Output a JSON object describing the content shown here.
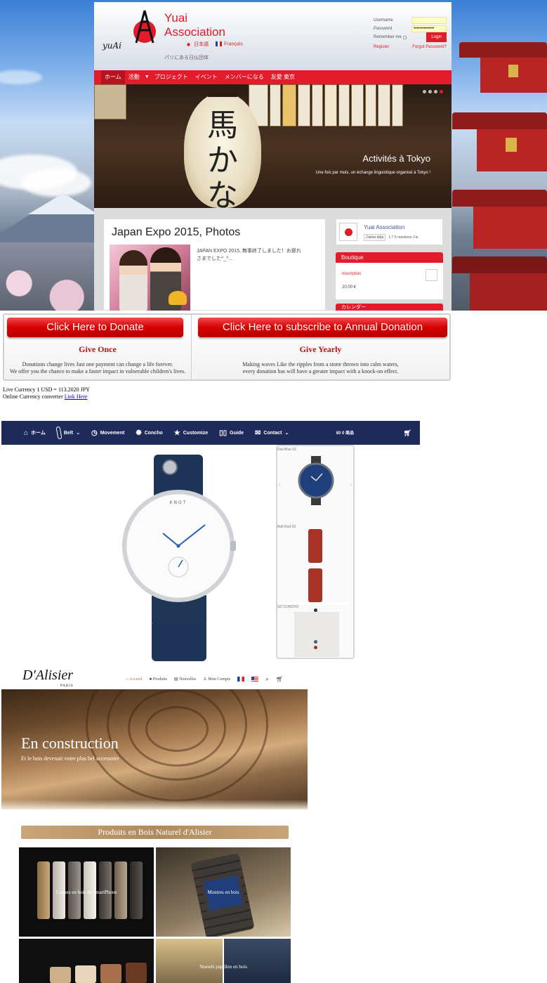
{
  "yuai": {
    "brand_line1": "Yuai",
    "brand_line2": "Association",
    "logo_text": "yuAi",
    "lang_ja": "日本語",
    "lang_fr": "Français",
    "tagline": "パリにある日仏団体",
    "login": {
      "username_label": "Username",
      "password_label": "Password",
      "password_value": "••••••••••••••",
      "remember_label": "Remember me",
      "login_button": "Login",
      "register_link": "Register",
      "forgot_link": "Forgot Password?"
    },
    "nav": [
      "ホーム",
      "活動",
      "プロジェクト",
      "イベント",
      "メンバーになる",
      "友愛 東京"
    ],
    "hero": {
      "title": "Activités à Tokyo",
      "text": "Une fois par mois, un échange linguistique organisé à Tokyo !",
      "lantern_text": "馬かない!"
    },
    "post": {
      "title": "Japan Expo 2015, Photos",
      "excerpt": "JAPAN EXPO 2015, 無事終了しました！お疲れさまでした^_^..."
    },
    "facebook": {
      "name": "Yuai Association",
      "like_button": "J'aime déjà",
      "likes": "1,7 K mentions J'ai"
    },
    "boutique": {
      "heading": "Boutique",
      "item": "Inscription",
      "price": "20.00 €"
    },
    "calendar_heading": "カレンダー"
  },
  "donate": {
    "once_button": "Click Here to Donate",
    "once_title": "Give Once",
    "once_text1": "Donations change lives Just one payment can change a life forever.",
    "once_text2": "We offer you the chance to make a faster impact in vulnerable children's lives.",
    "yearly_button": "Click Here to subscribe to Annual Donation",
    "yearly_title": "Give Yearly",
    "yearly_text1": "Making waves Like the ripples from a stone thrown into calm waters,",
    "yearly_text2": "every donation has will have a greater impact with a knock-on effect.",
    "currency": "Live Currency 1 USD = 113.2020 JPY",
    "converter_label": "Online Currency converter",
    "converter_link": "Link Here"
  },
  "watch": {
    "nav": [
      {
        "icon": "home-icon",
        "label": "ホーム",
        "dropdown": false
      },
      {
        "icon": "belt-icon",
        "label": "Belt",
        "dropdown": true
      },
      {
        "icon": "clock-icon",
        "label": "Movement",
        "dropdown": false
      },
      {
        "icon": "concho-icon",
        "label": "Concho",
        "dropdown": false
      },
      {
        "icon": "star-icon",
        "label": "Customize",
        "dropdown": false
      },
      {
        "icon": "book-icon",
        "label": "Guide",
        "dropdown": false
      },
      {
        "icon": "mail-icon",
        "label": "Contact",
        "dropdown": true
      }
    ],
    "cart_count": "¥0",
    "cart_count_label": "0 商品",
    "brand_on_dial": "KNOT",
    "panel": {
      "label1": "Dial Blue 02",
      "label2": "Belt Red 03",
      "label3": "SD CONCHO"
    }
  },
  "alisier": {
    "logo": "D'Alisier",
    "logo_sub": "PARIS",
    "nav": [
      "Accueil",
      "Produits",
      "Nouvelles",
      "Mon Compte"
    ],
    "hero_title": "En construction",
    "hero_text": "Et le bois devenait votre plus bel accessoire",
    "section_title": "Produits en Bois Naturel d'Alisier",
    "tile1": "Coques en bois de SmartPhone",
    "tile2": "Montres en bois",
    "tile3": "Noeuds papillon en bois"
  }
}
